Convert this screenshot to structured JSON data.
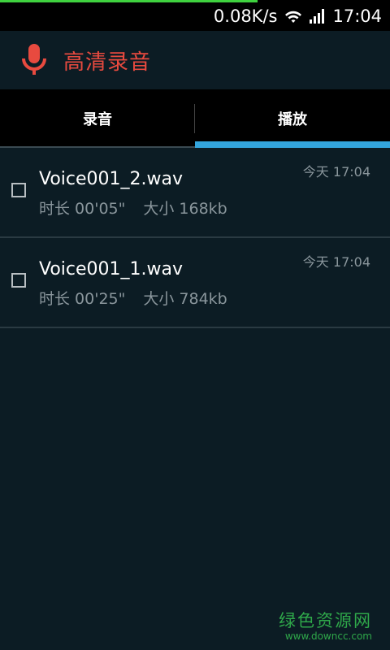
{
  "status_bar": {
    "net_speed": "0.08K/s",
    "time": "17:04",
    "progress_fraction": 0.66
  },
  "app": {
    "title": "高清录音",
    "accent_color": "#e84a3f"
  },
  "tabs": [
    {
      "label": "录音",
      "selected": false
    },
    {
      "label": "播放",
      "selected": true
    }
  ],
  "recordings": [
    {
      "name": "Voice001_2.wav",
      "duration": "时长 00'05\"",
      "size": "大小 168kb",
      "time": "今天 17:04",
      "checked": false
    },
    {
      "name": "Voice001_1.wav",
      "duration": "时长 00'25\"",
      "size": "大小 784kb",
      "time": "今天 17:04",
      "checked": false
    }
  ],
  "watermark": {
    "cn": "绿色资源网",
    "url": "www.downcc.com"
  }
}
